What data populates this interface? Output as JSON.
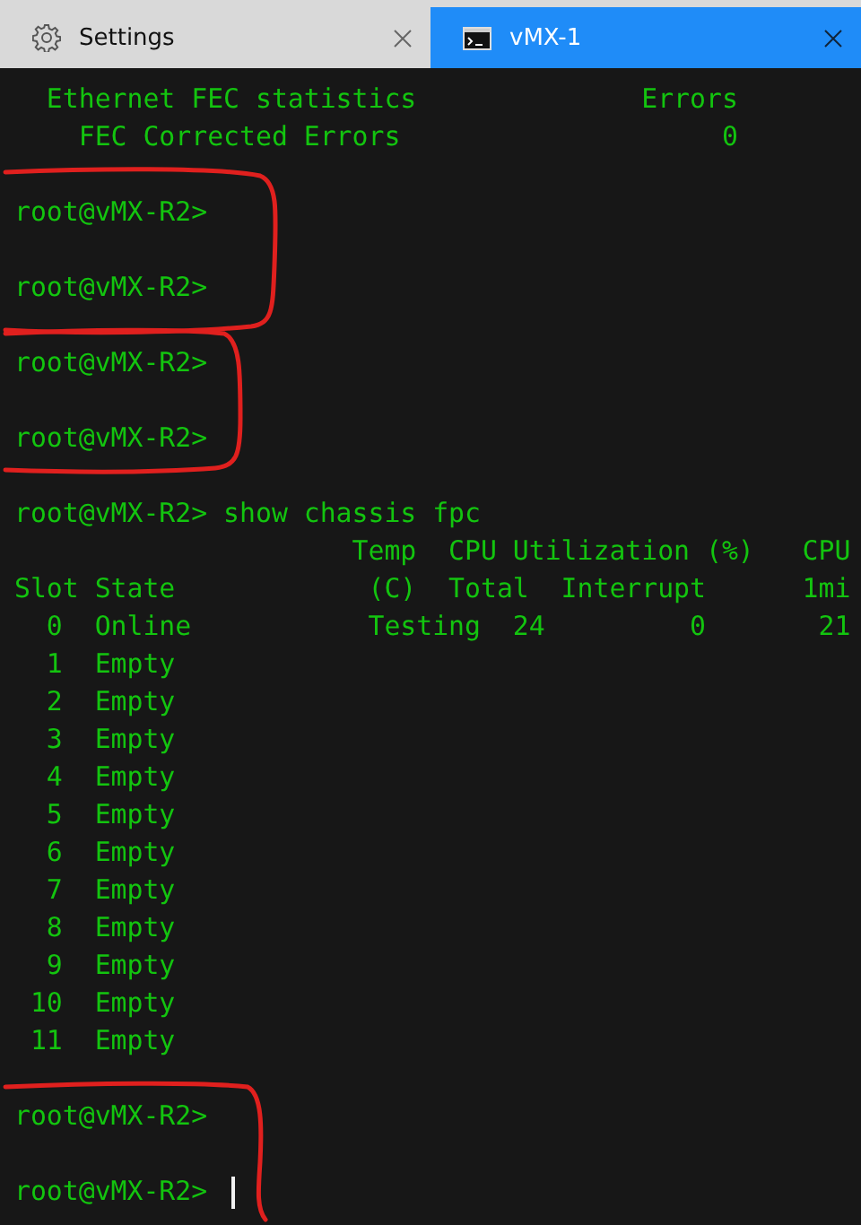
{
  "tabs": [
    {
      "label": "Settings",
      "kind": "settings",
      "selected": false
    },
    {
      "label": "vMX-1",
      "kind": "terminal",
      "selected": true
    }
  ],
  "terminal": {
    "lines": [
      {
        "kind": "output",
        "text": "  Ethernet FEC statistics              Errors"
      },
      {
        "kind": "output",
        "text": "    FEC Corrected Errors                    0"
      },
      {
        "kind": "blank"
      },
      {
        "kind": "prompt",
        "text": "root@vMX-R2>",
        "cursor": false
      },
      {
        "kind": "blank"
      },
      {
        "kind": "prompt",
        "text": "root@vMX-R2>",
        "cursor": false
      },
      {
        "kind": "blank"
      },
      {
        "kind": "prompt",
        "text": "root@vMX-R2>",
        "cursor": false
      },
      {
        "kind": "blank"
      },
      {
        "kind": "prompt",
        "text": "root@vMX-R2>",
        "cursor": false
      },
      {
        "kind": "blank"
      },
      {
        "kind": "prompt",
        "text": "root@vMX-R2> show chassis fpc",
        "cursor": false
      },
      {
        "kind": "output",
        "text": "                     Temp  CPU Utilization (%)   CPU"
      },
      {
        "kind": "output",
        "text": "Slot State            (C)  Total  Interrupt      1mi"
      },
      {
        "kind": "output",
        "text": "  0  Online           Testing  24         0       21"
      },
      {
        "kind": "output",
        "text": "  1  Empty"
      },
      {
        "kind": "output",
        "text": "  2  Empty"
      },
      {
        "kind": "output",
        "text": "  3  Empty"
      },
      {
        "kind": "output",
        "text": "  4  Empty"
      },
      {
        "kind": "output",
        "text": "  5  Empty"
      },
      {
        "kind": "output",
        "text": "  6  Empty"
      },
      {
        "kind": "output",
        "text": "  7  Empty"
      },
      {
        "kind": "output",
        "text": "  8  Empty"
      },
      {
        "kind": "output",
        "text": "  9  Empty"
      },
      {
        "kind": "output",
        "text": " 10  Empty"
      },
      {
        "kind": "output",
        "text": " 11  Empty"
      },
      {
        "kind": "blank"
      },
      {
        "kind": "prompt",
        "text": "root@vMX-R2>",
        "cursor": false
      },
      {
        "kind": "blank"
      },
      {
        "kind": "prompt",
        "text": "root@vMX-R2>",
        "cursor": true
      }
    ]
  }
}
